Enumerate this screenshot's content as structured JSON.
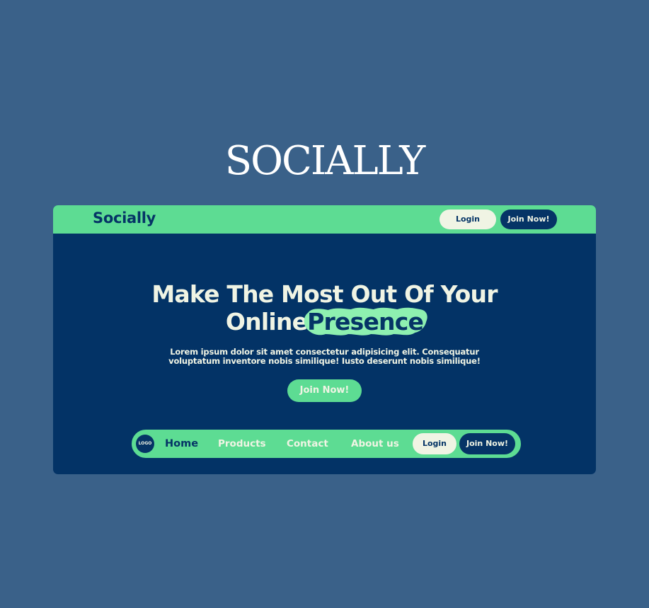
{
  "brand": {
    "title": "SOCIALLY"
  },
  "topbar": {
    "logo_text": "Socially",
    "login_label": "Login",
    "join_label": "Join Now!"
  },
  "hero": {
    "headline_line1": "Make The Most Out Of Your",
    "headline_line2_prefix": "Online",
    "headline_highlight": "Presence",
    "description": "Lorem ipsum dolor sit amet consectetur adipisicing elit. Consequatur voluptatum inventore nobis similique! Iusto deserunt nobis similique!",
    "cta_label": "Join Now!"
  },
  "navbar": {
    "logo_text": "LOGO",
    "items": [
      {
        "label": "Home",
        "active": true
      },
      {
        "label": "Products",
        "active": false
      },
      {
        "label": "Contact",
        "active": false
      },
      {
        "label": "About us",
        "active": false
      }
    ],
    "login_label": "Login",
    "join_label": "Join Now!"
  },
  "colors": {
    "page_background": "#3a6189",
    "frame_background": "#033366",
    "accent_green": "#5ddc93",
    "cream": "#f0f4e4",
    "navy": "#053466"
  }
}
